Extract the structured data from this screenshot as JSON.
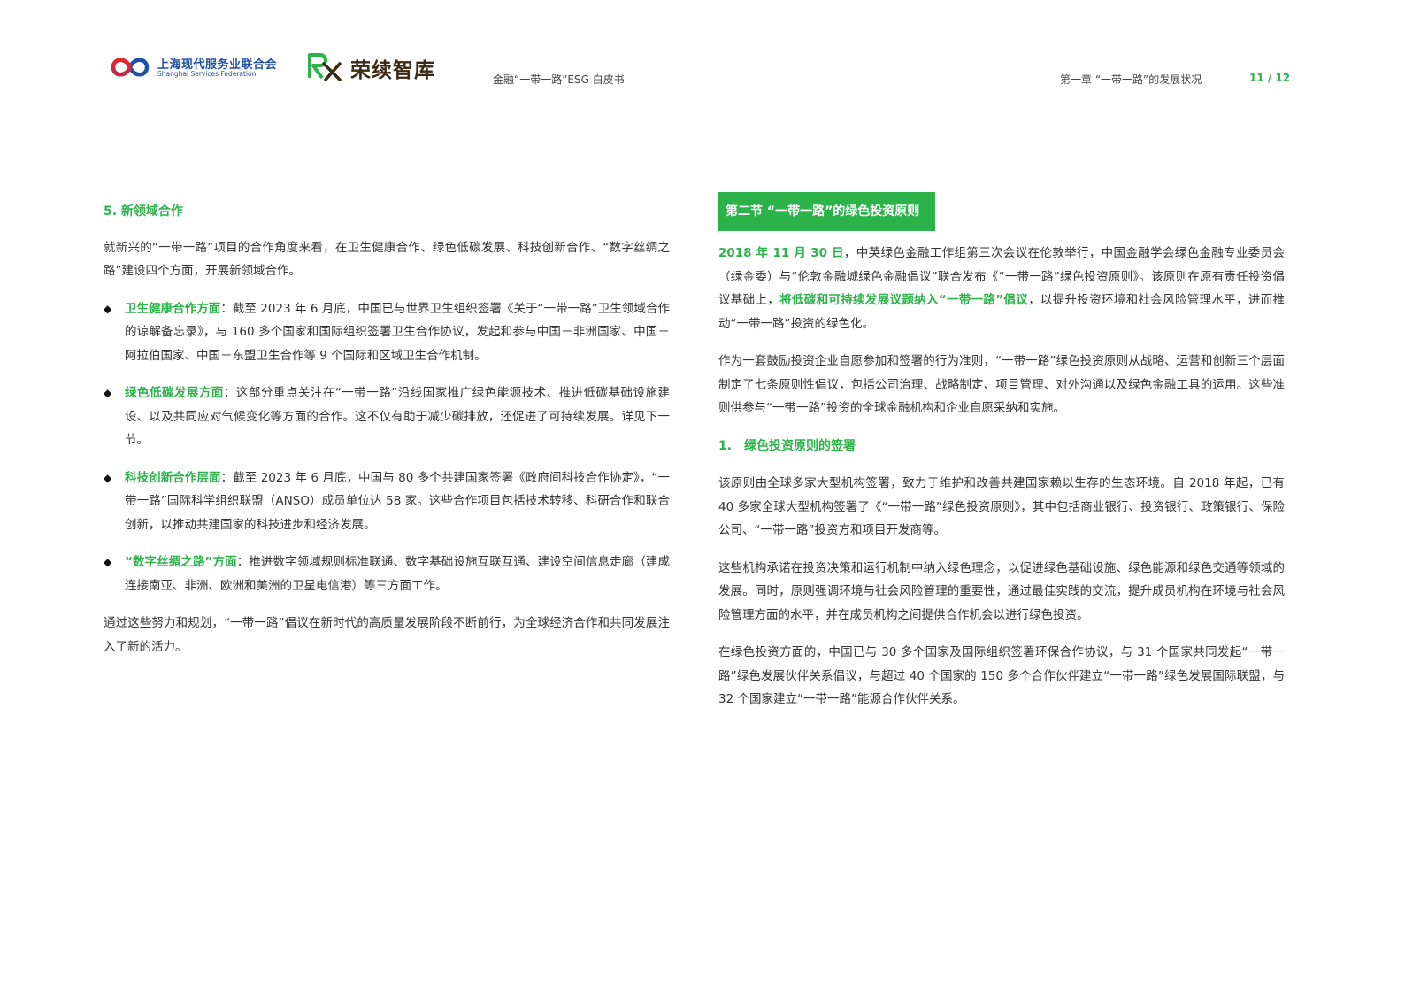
{
  "header": {
    "org_cn": "上海现代服务业联合会",
    "org_en": "Shanghai Services Federation",
    "brand": "荣续智库",
    "doc_title": "金融“一带一路”ESG 白皮书",
    "chapter": "第一章 “一带一路”的发展状况",
    "page": "11 / 12"
  },
  "left": {
    "heading": "5. 新领域合作",
    "intro": "就新兴的“一带一路”项目的合作角度来看，在卫生健康合作、绿色低碳发展、科技创新合作、“数字丝绸之路”建设四个方面，开展新领域合作。",
    "bullets": [
      {
        "mark": "◆",
        "title": "卫生健康合作方面",
        "text": "：截至 2023 年 6 月底，中国已与世界卫生组织签署《关于“一带一路”卫生领域合作的谅解备忘录》，与 160 多个国家和国际组织签署卫生合作协议，发起和参与中国－非洲国家、中国－阿拉伯国家、中国－东盟卫生合作等 9 个国际和区域卫生合作机制。"
      },
      {
        "mark": "◆",
        "title": "绿色低碳发展方面",
        "text": "：这部分重点关注在“一带一路”沿线国家推广绿色能源技术、推进低碳基础设施建设、以及共同应对气候变化等方面的合作。这不仅有助于减少碳排放，还促进了可持续发展。详见下一节。"
      },
      {
        "mark": "◆",
        "title": "科技创新合作层面",
        "text": "：截至 2023 年 6 月底，中国与 80 多个共建国家签署《政府间科技合作协定》，“一带一路”国际科学组织联盟（ANSO）成员单位达 58 家。这些合作项目包括技术转移、科研合作和联合创新，以推动共建国家的科技进步和经济发展。"
      },
      {
        "mark": "◆",
        "title": "“数字丝绸之路”方面",
        "text": "：推进数字领域规则标准联通、数字基础设施互联互通、建设空间信息走廊（建成连接南亚、非洲、欧洲和美洲的卫星电信港）等三方面工作。"
      }
    ],
    "conclusion": "通过这些努力和规划，“一带一路”倡议在新时代的高质量发展阶段不断前行，为全球经济合作和共同发展注入了新的活力。"
  },
  "right": {
    "section_title": "第二节 “一带一路”的绿色投资原则",
    "p1": {
      "date": "2018 年 11 月 30 日",
      "text1": "，中英绿色金融工作组第三次会议在伦敦举行，中国金融学会绿色金融专业委员会（绿金委）与“伦敦金融城绿色金融倡议”联合发布《“一带一路”绿色投资原则》。该原则在原有责任投资倡议基础上，",
      "highlight": "将低碳和可持续发展议题纳入“一带一路”倡议",
      "text2": "，以提升投资环境和社会风险管理水平，进而推动“一带一路”投资的绿色化。"
    },
    "p2": "作为一套鼓励投资企业自愿参加和签署的行为准则，“一带一路”绿色投资原则从战略、运营和创新三个层面制定了七条原则性倡议，包括公司治理、战略制定、项目管理、对外沟通以及绿色金融工具的运用。这些准则供参与“一带一路”投资的全球金融机构和企业自愿采纳和实施。",
    "subheading": "1.　绿色投资原则的签署",
    "p3": "该原则由全球多家大型机构签署，致力于维护和改善共建国家赖以生存的生态环境。自 2018 年起，已有 40 多家全球大型机构签署了《“一带一路”绿色投资原则》，其中包括商业银行、投资银行、政策银行、保险公司、“一带一路”投资方和项目开发商等。",
    "p4": "这些机构承诺在投资决策和运行机制中纳入绿色理念，以促进绿色基础设施、绿色能源和绿色交通等领域的发展。同时，原则强调环境与社会风险管理的重要性，通过最佳实践的交流，提升成员机构在环境与社会风险管理方面的水平，并在成员机构之间提供合作机会以进行绿色投资。",
    "p5": "在绿色投资方面的，中国已与 30 多个国家及国际组织签署环保合作协议，与 31 个国家共同发起“一带一路”绿色发展伙伴关系倡议，与超过 40 个国家的 150 多个合作伙伴建立“一带一路”绿色发展国际联盟，与 32 个国家建立“一带一路”能源合作伙伴关系。"
  },
  "colors": {
    "accent_green": "#2bb34a",
    "text": "#333333",
    "ssf_blue": "#1e4fa0",
    "ssf_red": "#e0262f",
    "rx_green": "#2bb34a",
    "rx_brown": "#3a2a14"
  },
  "icons": {
    "ssf_logo": "ssf-knot-logo",
    "rx_logo": "rx-monogram-logo",
    "bullet": "diamond-bullet-icon"
  }
}
